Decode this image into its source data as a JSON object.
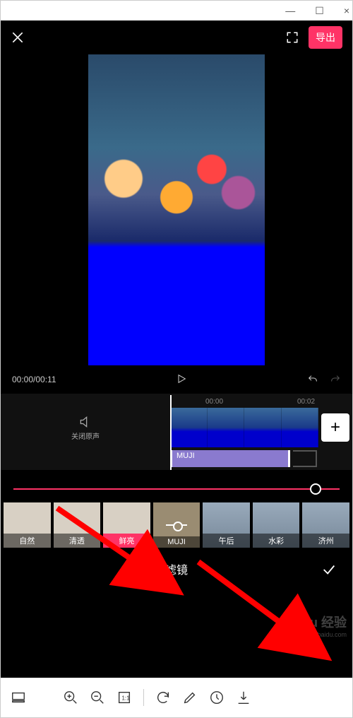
{
  "window_controls": {
    "min": "—",
    "max": "☐",
    "close": "×"
  },
  "header": {
    "export_label": "导出"
  },
  "transport": {
    "current": "00:00",
    "duration": "00:11",
    "time_display": "00:00/00:11"
  },
  "timeline": {
    "ruler_marks": [
      "00:00",
      "00:02"
    ],
    "audio_off_label": "关闭原声",
    "filter_clip_label": "MUJI"
  },
  "filter_items": [
    {
      "label": "自然",
      "style": "light"
    },
    {
      "label": "清透",
      "style": "light"
    },
    {
      "label": "鲜亮",
      "style": "light",
      "selected": true
    },
    {
      "label": "MUJI",
      "style": "muji"
    },
    {
      "label": "午后",
      "style": "person"
    },
    {
      "label": "水彩",
      "style": "person"
    },
    {
      "label": "济州",
      "style": "person"
    }
  ],
  "bottom_tab_label": "滤镜",
  "watermark": {
    "main": "Baidu 经验",
    "sub": "jingyan.baidu.com"
  }
}
